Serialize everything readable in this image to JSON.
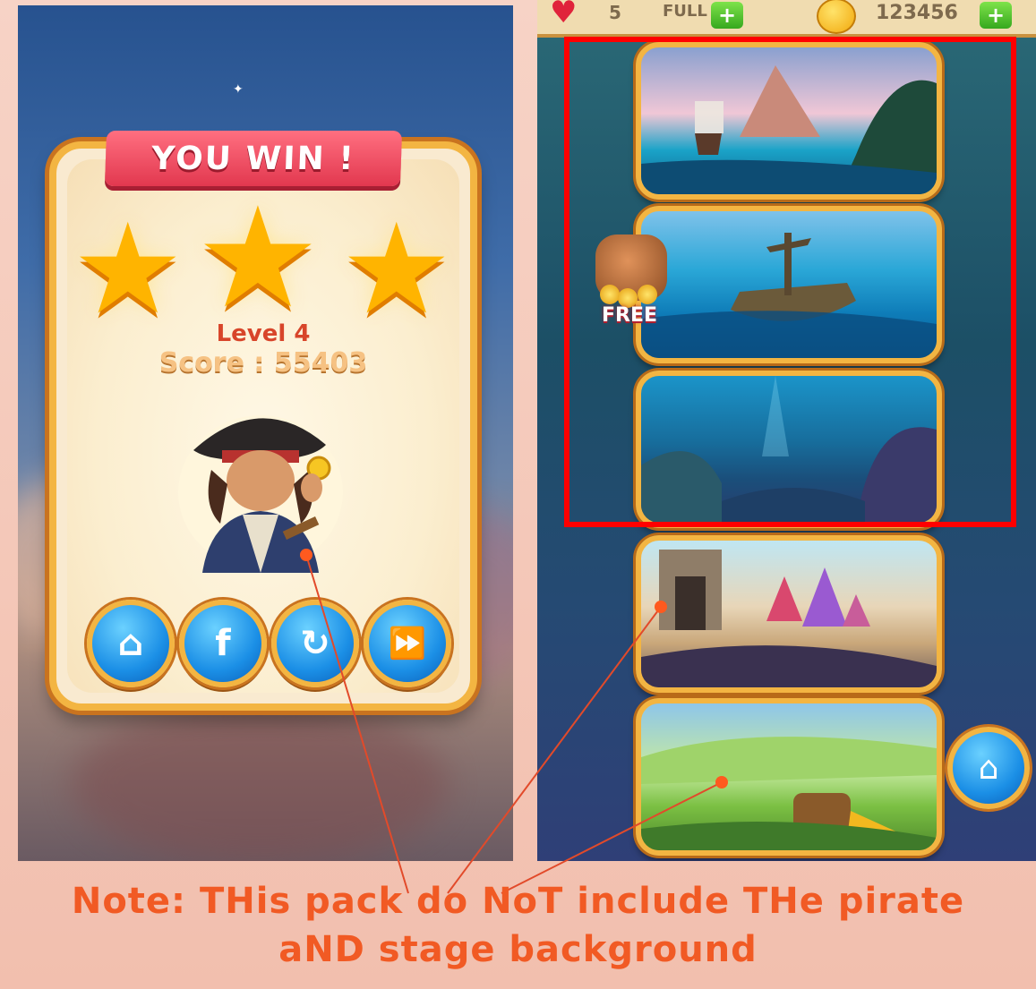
{
  "win_screen": {
    "title": "YOU WIN !",
    "level": "Level 4",
    "score": "Score : 55403",
    "stars": [
      "★",
      "★",
      "★"
    ],
    "buttons": [
      {
        "name": "home",
        "glyph": "⌂"
      },
      {
        "name": "facebook",
        "glyph": "f"
      },
      {
        "name": "replay",
        "glyph": "↻"
      },
      {
        "name": "next",
        "glyph": "⏩"
      }
    ]
  },
  "top_bar": {
    "lives": "5",
    "lives_status": "FULL",
    "plus": "+",
    "coins": "123456"
  },
  "stage_select": {
    "free_label": "FREE",
    "home_glyph": "⌂"
  },
  "note": {
    "line1": "Note: THis pack do NoT include THe pirate",
    "line2": "aND stage background"
  },
  "colors": {
    "highlight": "#ff0000",
    "note_text": "#f15a24",
    "card_border": "#f3b542",
    "button_blue": "#1b8fe6"
  }
}
